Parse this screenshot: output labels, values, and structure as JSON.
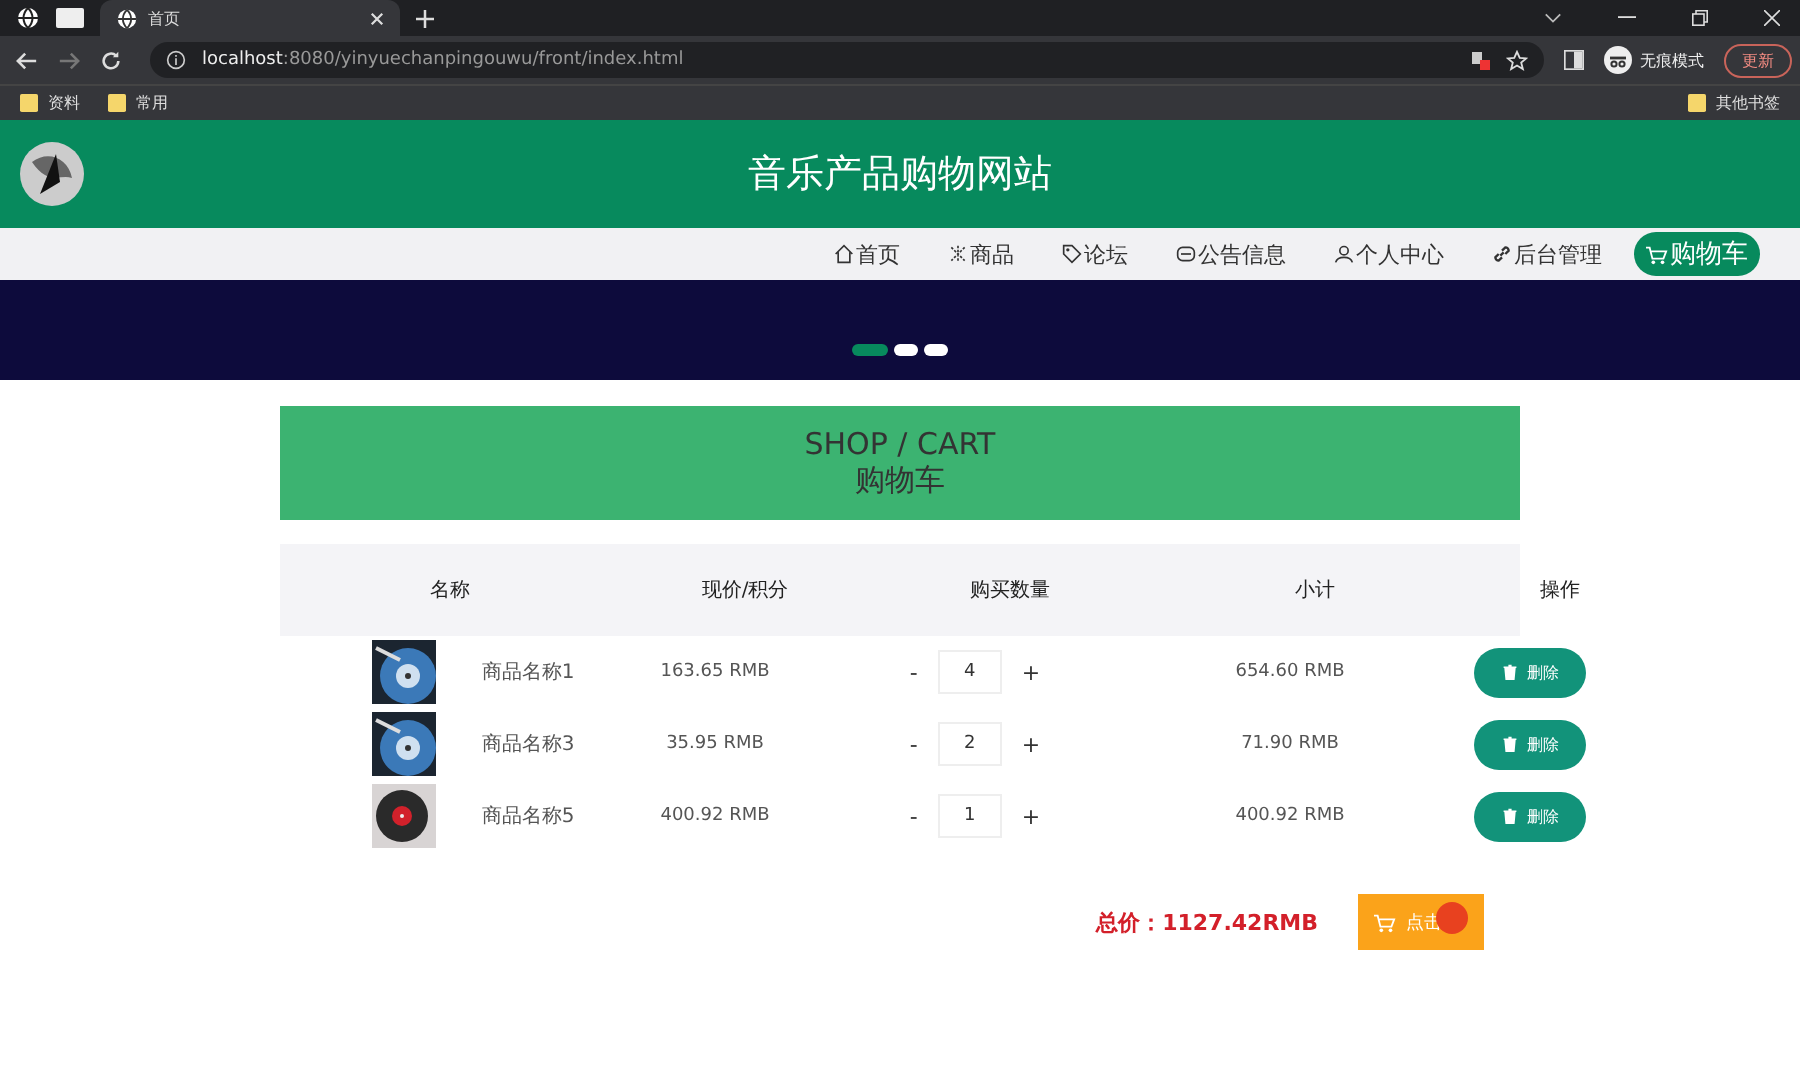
{
  "browser": {
    "tab_title": "首页",
    "url_host": "localhost",
    "url_rest": ":8080/yinyuechanpingouwu/front/index.html",
    "profile": "无痕模式",
    "update_button": "更新",
    "bookmarks": [
      "资料",
      "常用"
    ],
    "other_bookmarks": "其他书签"
  },
  "site": {
    "title": "音乐产品购物网站"
  },
  "nav": [
    {
      "label": "首页",
      "kind": "home",
      "selected": false
    },
    {
      "label": "商品",
      "kind": "goods",
      "selected": false
    },
    {
      "label": "论坛",
      "kind": "tag",
      "selected": false
    },
    {
      "label": "公告信息",
      "kind": "notice",
      "selected": false
    },
    {
      "label": "个人中心",
      "kind": "user",
      "selected": false
    },
    {
      "label": "后台管理",
      "kind": "link",
      "selected": false
    },
    {
      "label": "购物车",
      "kind": "cart",
      "selected": true
    }
  ],
  "carousel": [
    {
      "selected": true
    },
    {
      "selected": false
    },
    {
      "selected": false
    }
  ],
  "cart": {
    "title_en": "SHOP / CART",
    "title_cn": "购物车",
    "columns": [
      "名称",
      "现价/积分",
      "购买数量",
      "小计",
      "操作"
    ],
    "rows": [
      {
        "name": "商品名称1",
        "price": "163.65 RMB",
        "minus": "-",
        "qty": "4",
        "plus": "+",
        "subtotal": "654.60 RMB",
        "action": "删除"
      },
      {
        "name": "商品名称3",
        "price": "35.95 RMB",
        "minus": "-",
        "qty": "2",
        "plus": "+",
        "subtotal": "71.90 RMB",
        "action": "删除"
      },
      {
        "name": "商品名称5",
        "price": "400.92 RMB",
        "minus": "-",
        "qty": "1",
        "plus": "+",
        "subtotal": "400.92 RMB",
        "action": "删除"
      }
    ],
    "total": "总价：1127.42RMB",
    "buy_button": "点击"
  }
}
